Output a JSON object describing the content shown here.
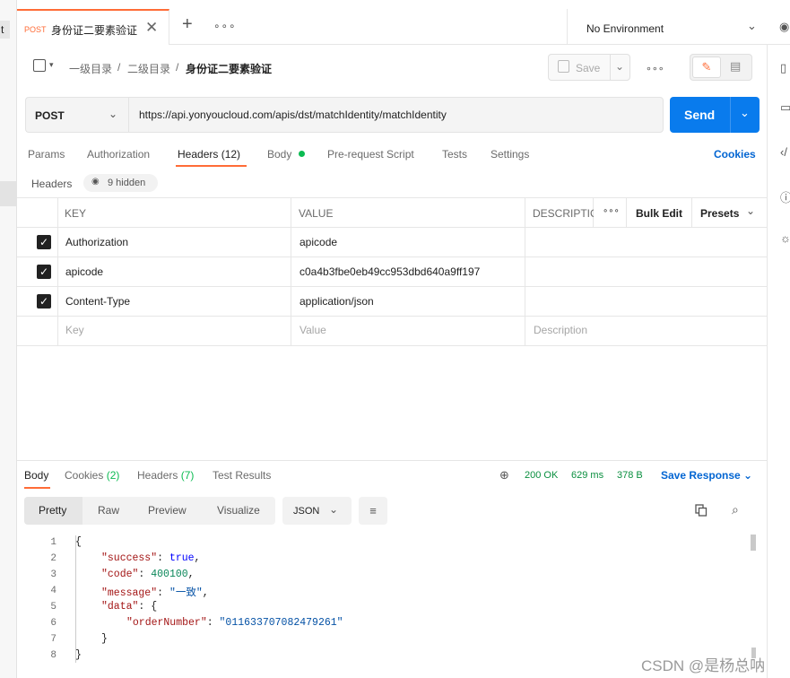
{
  "left_strip": {
    "tab_fragment": "t"
  },
  "tab": {
    "method": "POST",
    "name": "身份证二要素验证",
    "close": "✕",
    "new": "+",
    "more": "∘∘∘"
  },
  "environment": {
    "label": "No Environment",
    "chevron": "⌄"
  },
  "breadcrumb": {
    "caret": "▾",
    "items": [
      "一级目录",
      "二级目录",
      "身份证二要素验证"
    ],
    "sep": "/"
  },
  "toolbar": {
    "save_label": "Save",
    "more": "∘∘∘"
  },
  "request": {
    "method": "POST",
    "url": "https://api.yonyoucloud.com/apis/dst/matchIdentity/matchIdentity",
    "send_label": "Send"
  },
  "request_tabs": [
    "Params",
    "Authorization",
    "Headers (12)",
    "Body",
    "Pre-request Script",
    "Tests",
    "Settings"
  ],
  "cookies_label": "Cookies",
  "headers_section": {
    "label": "Headers",
    "hidden_label": "9 hidden"
  },
  "table": {
    "columns": {
      "key": "KEY",
      "value": "VALUE",
      "description": "DESCRIPTIC"
    },
    "more": "∘∘∘",
    "bulk_edit": "Bulk Edit",
    "presets": "Presets",
    "rows": [
      {
        "key": "Authorization",
        "value": "apicode"
      },
      {
        "key": "apicode",
        "value": "c0a4b3fbe0eb49cc953dbd640a9ff197"
      },
      {
        "key": "Content-Type",
        "value": "application/json"
      }
    ],
    "placeholders": {
      "key": "Key",
      "value": "Value",
      "description": "Description"
    }
  },
  "response_tabs": {
    "body": "Body",
    "cookies": "Cookies",
    "cookies_count": "(2)",
    "headers": "Headers",
    "headers_count": "(7)",
    "tests": "Test Results"
  },
  "response_meta": {
    "status": "200 OK",
    "time": "629 ms",
    "size": "378 B",
    "save_label": "Save Response"
  },
  "view_modes": [
    "Pretty",
    "Raw",
    "Preview",
    "Visualize"
  ],
  "format": "JSON",
  "code_lines": [
    "1",
    "2",
    "3",
    "4",
    "5",
    "6",
    "7",
    "8"
  ],
  "json": {
    "success_key": "\"success\"",
    "success_val": "true",
    "code_key": "\"code\"",
    "code_val": "400100",
    "message_key": "\"message\"",
    "message_val": "\"一致\"",
    "data_key": "\"data\"",
    "order_key": "\"orderNumber\"",
    "order_val": "\"011633707082479261\""
  },
  "watermark": "CSDN @是杨总呐",
  "colors": {
    "accent": "#ff6c37",
    "primary": "#097bed",
    "success": "#0cbb52",
    "link": "#0265d2"
  }
}
